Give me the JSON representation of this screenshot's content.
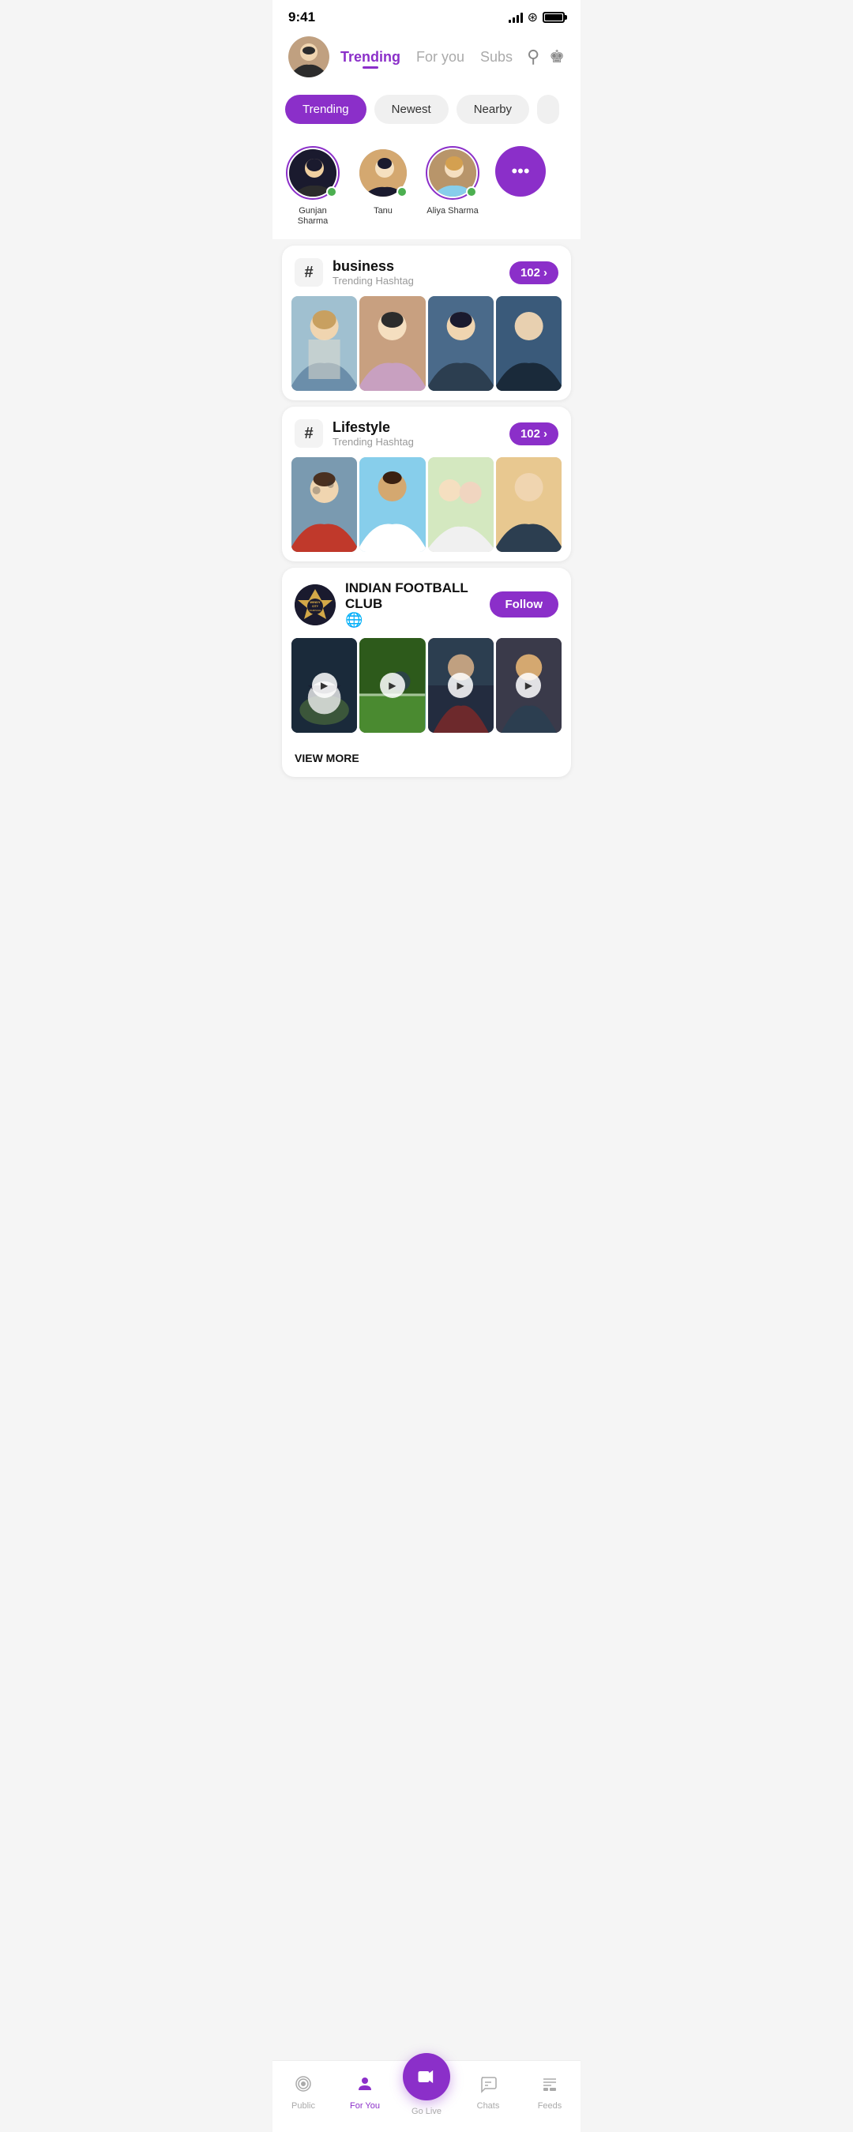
{
  "statusBar": {
    "time": "9:41",
    "battery": "full"
  },
  "header": {
    "navItems": [
      {
        "label": "Trending",
        "active": true
      },
      {
        "label": "For you",
        "active": false
      },
      {
        "label": "Subs",
        "active": false
      }
    ]
  },
  "filterTabs": [
    {
      "label": "Trending",
      "active": true
    },
    {
      "label": "Newest",
      "active": false
    },
    {
      "label": "Nearby",
      "active": false
    }
  ],
  "stories": [
    {
      "name": "Gunjan Sharma",
      "online": true,
      "hasRing": true
    },
    {
      "name": "Tanu",
      "online": true,
      "hasRing": false
    },
    {
      "name": "Aliya Sharma",
      "online": true,
      "hasRing": true
    }
  ],
  "hashtags": [
    {
      "tag": "business",
      "sub": "Trending Hashtag",
      "count": "102"
    },
    {
      "tag": "Lifestyle",
      "sub": "Trending Hashtag",
      "count": "102"
    }
  ],
  "club": {
    "name": "INDIAN FOOTBALL CLUB",
    "logoText": "WINDY city",
    "follow": "Follow",
    "viewMore": "VIEW MORE"
  },
  "bottomNav": {
    "tabs": [
      {
        "label": "Public",
        "icon": "radio",
        "active": false
      },
      {
        "label": "For You",
        "icon": "person",
        "active": true
      },
      {
        "label": "Go Live",
        "icon": "camera",
        "active": false
      },
      {
        "label": "Chats",
        "icon": "chat",
        "active": false
      },
      {
        "label": "Feeds",
        "icon": "feeds",
        "active": false
      }
    ]
  }
}
